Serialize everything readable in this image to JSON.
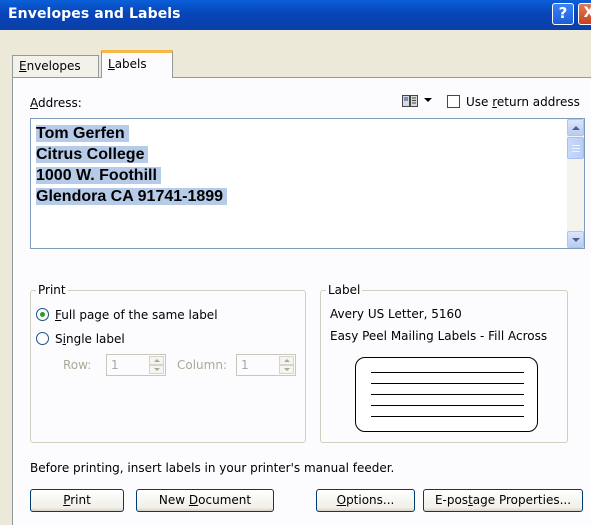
{
  "window": {
    "title": "Envelopes and Labels",
    "help_glyph": "?",
    "close_glyph": "X"
  },
  "tabs": [
    {
      "label": "Envelopes",
      "access_key": "E",
      "rest": "nvelopes",
      "selected": false
    },
    {
      "label": "Labels",
      "access_key": "L",
      "rest": "abels",
      "selected": true
    }
  ],
  "address": {
    "label": "Address:",
    "access_key": "A",
    "label_rest": "ddress:",
    "lines": [
      "Tom Gerfen",
      "Citrus College",
      "1000 W. Foothill",
      "Glendora CA 91741-1899"
    ],
    "address_book_icon": "address-book-icon",
    "use_return_address_label": "Use return address",
    "use_return_address_key": "r",
    "use_return_address_pre": "Use ",
    "use_return_address_post": "eturn address",
    "use_return_address_checked": false
  },
  "print_group": {
    "title": "Print",
    "full_page_label": "Full page of the same label",
    "full_page_key": "F",
    "full_page_rest": "ull page of the same label",
    "full_page_selected": true,
    "single_label": "Single label",
    "single_pre": "S",
    "single_key": "i",
    "single_rest": "ngle label",
    "single_selected": false,
    "row_label": "Row:",
    "row_value": "1",
    "column_label": "Column:",
    "column_value": "1"
  },
  "label_group": {
    "title": "Label",
    "product": "Avery US Letter, 5160",
    "description": "Easy Peel Mailing Labels - Fill Across"
  },
  "note": "Before printing, insert labels in your printer's manual feeder.",
  "buttons": {
    "print": {
      "label": "Print",
      "key": "P",
      "rest": "rint"
    },
    "new_document": {
      "label": "New Document",
      "pre": "New ",
      "key": "D",
      "rest": "ocument"
    },
    "options": {
      "label": "Options...",
      "key": "O",
      "rest": "ptions..."
    },
    "epostage": {
      "label": "E-postage Properties...",
      "pre": "E-pos",
      "key": "t",
      "rest": "age Properties..."
    }
  },
  "colors": {
    "title_bar": "#0a4fc8",
    "selection_highlight": "#b6cbe8",
    "radio_dot": "#21a121",
    "active_tab_accent": "#f7b846"
  }
}
